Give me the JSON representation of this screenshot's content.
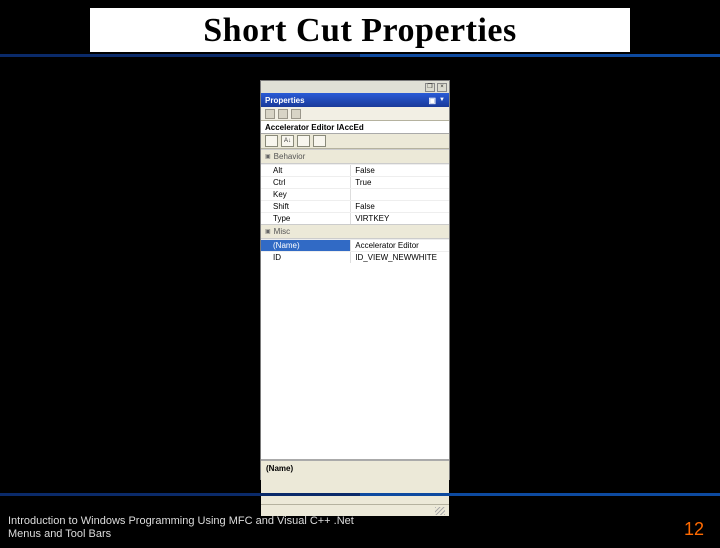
{
  "slide": {
    "title": "Short Cut Properties",
    "footer_line1": "Introduction to Windows Programming Using MFC and Visual C++ .Net",
    "footer_line2": "Menus and Tool Bars",
    "page_number": "12"
  },
  "window": {
    "close_glyph": "×",
    "restore_glyph": "❐"
  },
  "properties": {
    "header_title": "Properties",
    "header_pin": "▣",
    "header_arrow": "▼",
    "object_line": "Accelerator Editor  IAccEd",
    "toolbar": {
      "mode_az": "A↓"
    },
    "groups": {
      "behavior": {
        "label": "Behavior",
        "rows": [
          {
            "key": "Alt",
            "value": "False"
          },
          {
            "key": "Ctrl",
            "value": "True"
          },
          {
            "key": "Key",
            "value": ""
          },
          {
            "key": "Shift",
            "value": "False"
          },
          {
            "key": "Type",
            "value": "VIRTKEY"
          }
        ]
      },
      "misc": {
        "label": "Misc",
        "rows": [
          {
            "key": "(Name)",
            "value": "Accelerator Editor"
          },
          {
            "key": "ID",
            "value": "ID_VIEW_NEWWHITE"
          }
        ]
      }
    },
    "desc_name": "(Name)"
  }
}
